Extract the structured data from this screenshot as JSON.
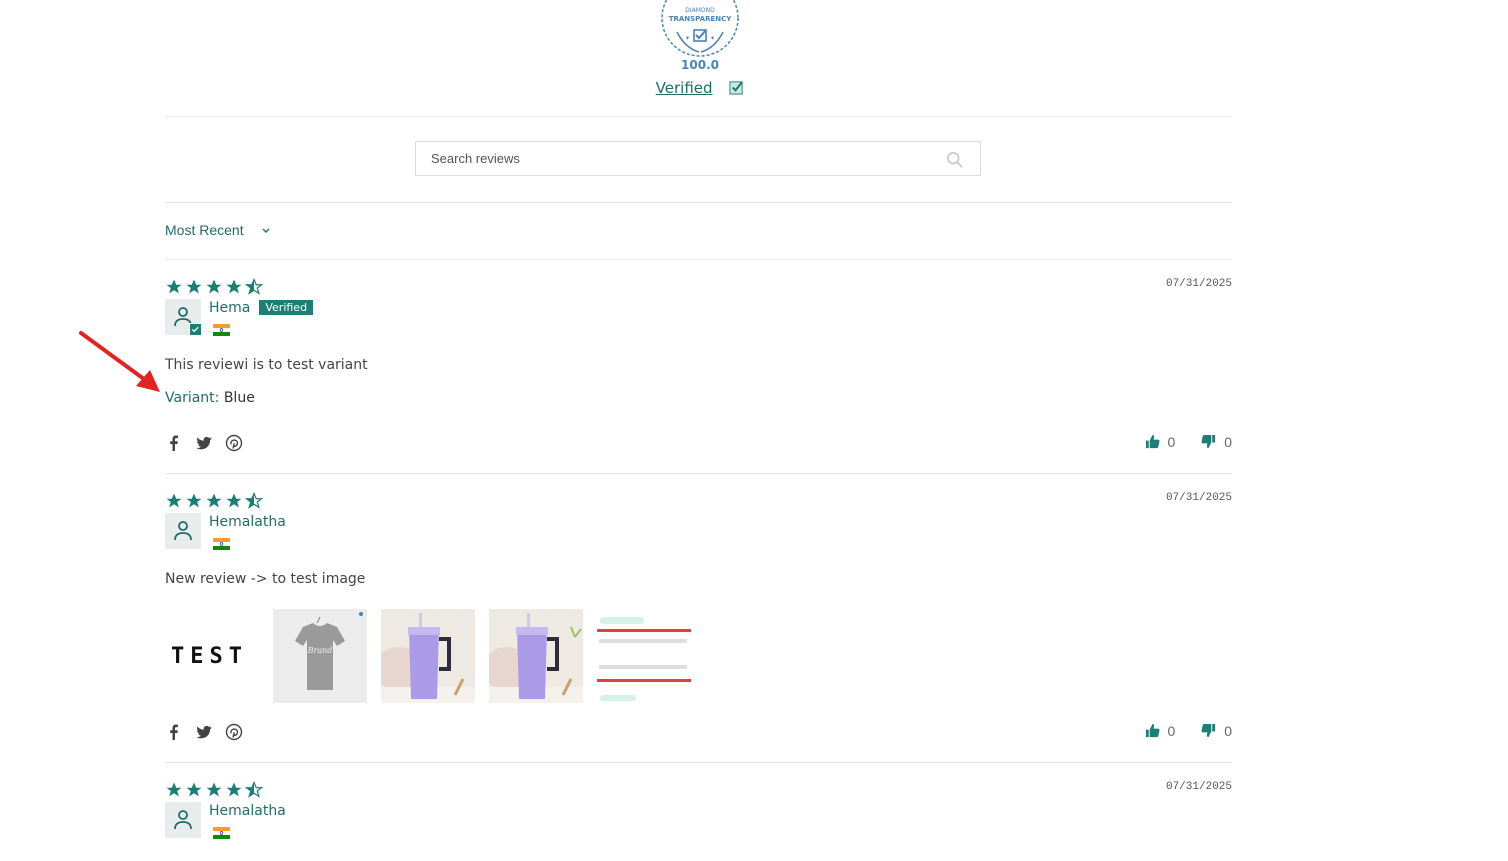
{
  "header": {
    "badge_line1": "DIAMOND",
    "badge_line2": "TRANSPARENCY",
    "score": "100.0",
    "verified_label": "Verified"
  },
  "search": {
    "placeholder": "Search reviews"
  },
  "sort": {
    "label": "Most Recent"
  },
  "colors": {
    "accent": "#1f7e74",
    "link": "#1f6d6a",
    "arrow": "#e02424",
    "badge_blue": "#4a83b5"
  },
  "reviews": [
    {
      "rating": 4.5,
      "date": "07/31/2025",
      "author": "Hema",
      "verified_badge": "Verified",
      "text": "This reviewi is to test variant",
      "variant_key": "Variant:",
      "variant_value": "Blue",
      "likes": "0",
      "dislikes": "0"
    },
    {
      "rating": 4.5,
      "date": "07/31/2025",
      "author": "Hemalatha",
      "text": "New review -> to test image",
      "thumb_text": "TEST",
      "likes": "0",
      "dislikes": "0"
    },
    {
      "rating": 4.5,
      "date": "07/31/2025",
      "author": "Hemalatha"
    }
  ],
  "icons": [
    "facebook-icon",
    "twitter-icon",
    "pinterest-icon",
    "thumbs-up-icon",
    "thumbs-down-icon",
    "search-icon",
    "user-icon",
    "india-flag-icon"
  ]
}
